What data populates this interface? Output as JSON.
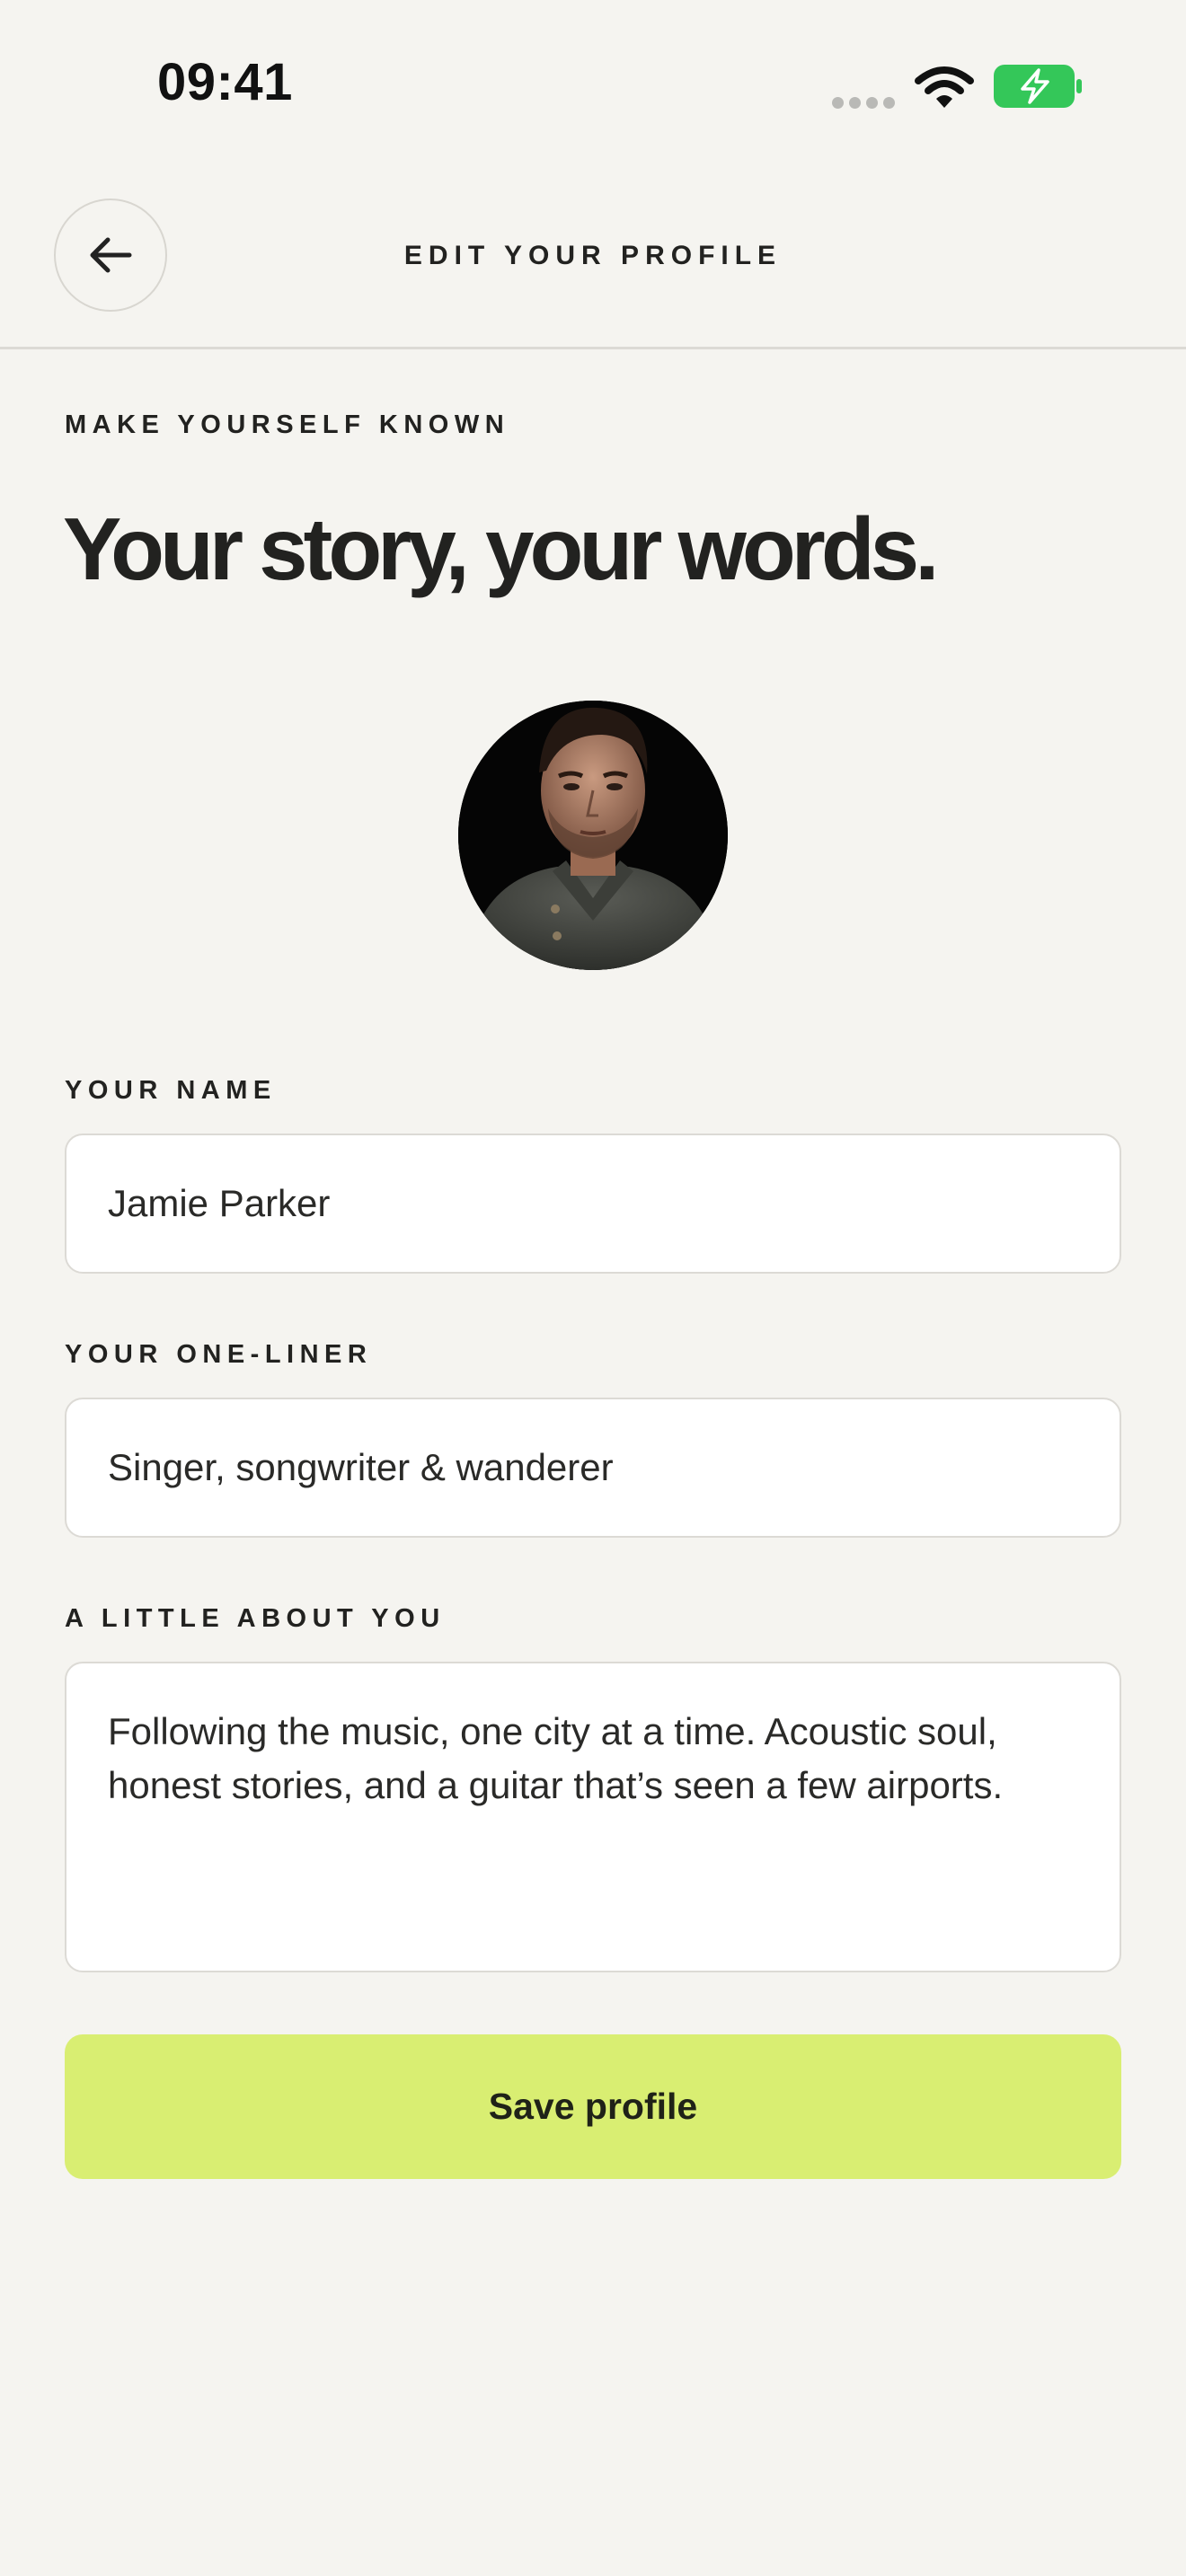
{
  "status_bar": {
    "time": "09:41",
    "battery_color": "#34c759"
  },
  "nav": {
    "title": "EDIT YOUR PROFILE",
    "back_icon": "arrow-left-icon"
  },
  "intro": {
    "eyebrow": "MAKE YOURSELF KNOWN",
    "headline": "Your story, your words."
  },
  "avatar": {
    "icon": "profile-photo"
  },
  "form": {
    "name": {
      "label": "YOUR NAME",
      "value": "Jamie Parker"
    },
    "one_liner": {
      "label": "YOUR ONE-LINER",
      "value": "Singer, songwriter & wanderer"
    },
    "about": {
      "label": "A LITTLE ABOUT YOU",
      "value": "Following the music, one city at a time. Acoustic soul, honest stories, and a guitar that’s seen a few airports."
    }
  },
  "actions": {
    "save_label": "Save profile",
    "accent_color": "#d9ee72"
  }
}
